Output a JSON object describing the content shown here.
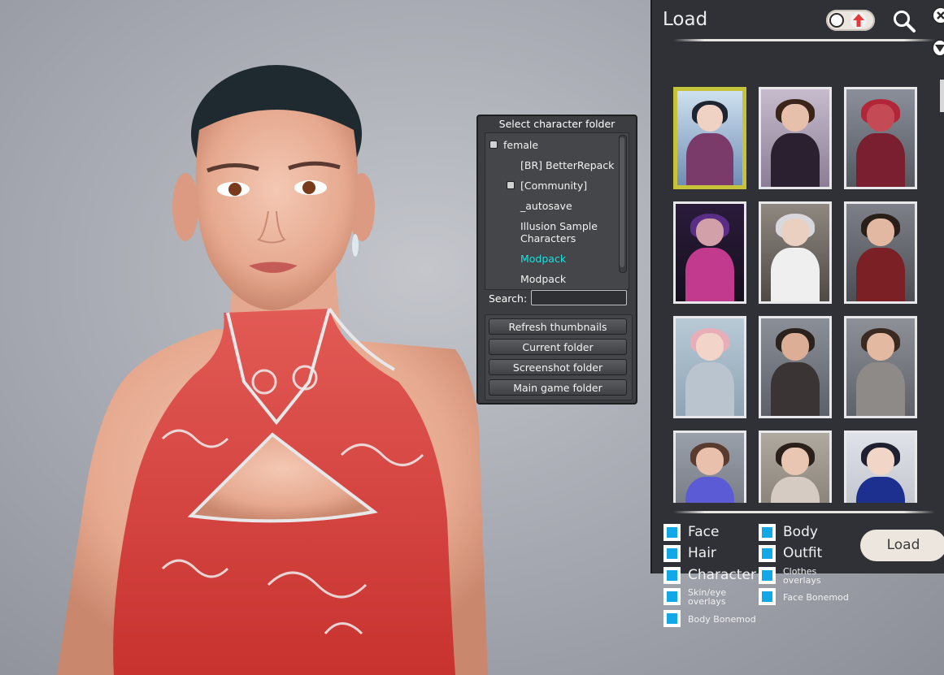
{
  "folder_dialog": {
    "title": "Select character folder",
    "tree": [
      {
        "label": "female",
        "has_toggle": true,
        "active": false
      },
      {
        "label": "[BR] BetterRepack",
        "has_toggle": false,
        "active": false
      },
      {
        "label": "[Community]",
        "has_toggle": true,
        "active": false
      },
      {
        "label": "_autosave",
        "has_toggle": false,
        "active": false
      },
      {
        "label": "Illusion Sample",
        "label2": "Characters",
        "has_toggle": false,
        "active": false
      },
      {
        "label": "Modpack",
        "has_toggle": false,
        "active": true
      },
      {
        "label": "Modpack",
        "has_toggle": false,
        "active": false
      }
    ],
    "search_label": "Search:",
    "search_value": "",
    "buttons": [
      "Refresh thumbnails",
      "Current folder",
      "Screenshot folder",
      "Main game folder"
    ]
  },
  "load_panel": {
    "title": "Load",
    "thumbnails": [
      {
        "name": "card-1",
        "selected": true
      },
      {
        "name": "card-2",
        "selected": false
      },
      {
        "name": "card-3",
        "selected": false
      },
      {
        "name": "card-4",
        "selected": false
      },
      {
        "name": "card-5",
        "selected": false
      },
      {
        "name": "card-6",
        "selected": false
      },
      {
        "name": "card-7",
        "selected": false
      },
      {
        "name": "card-8",
        "selected": false
      },
      {
        "name": "card-9",
        "selected": false
      },
      {
        "name": "card-10",
        "selected": false
      },
      {
        "name": "card-11",
        "selected": false
      },
      {
        "name": "card-12",
        "selected": false
      }
    ],
    "options": {
      "face": "Face",
      "body": "Body",
      "hair": "Hair",
      "outfit": "Outfit",
      "character": "Character",
      "clothes_overlays_1": "Clothes",
      "clothes_overlays_2": "overlays",
      "skin_eye_1": "Skin/eye",
      "skin_eye_2": "overlays",
      "face_bonemod": "Face Bonemod",
      "body_bonemod": "Body Bonemod"
    },
    "load_button": "Load"
  },
  "colors": {
    "accent_checkbox": "#12a7e6",
    "active_tree_item": "#19e0e0",
    "selected_thumbnail_border": "#c6c23a",
    "panel_bg": "#2f3136"
  }
}
